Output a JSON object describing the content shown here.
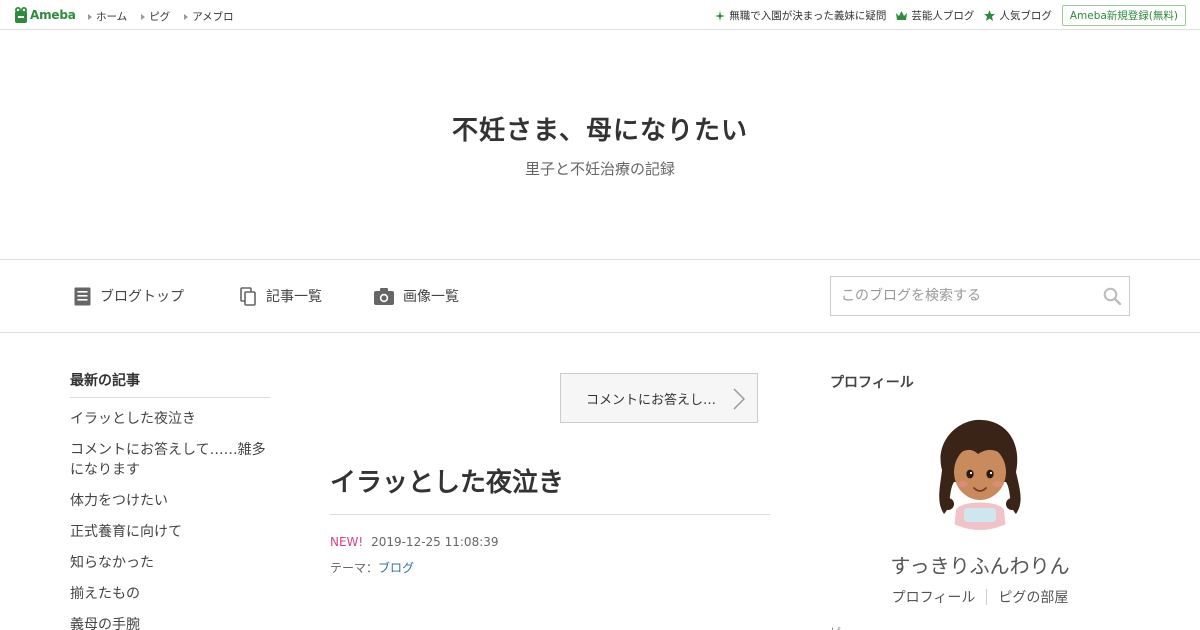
{
  "topbar": {
    "logo_text": "Ameba",
    "nav": [
      "ホーム",
      "ピグ",
      "アメブロ"
    ],
    "links": [
      {
        "icon": "sparkle-icon",
        "label": "無職で入園が決まった義妹に疑問"
      },
      {
        "icon": "crown-icon",
        "label": "芸能人ブログ"
      },
      {
        "icon": "star-icon",
        "label": "人気ブログ"
      }
    ],
    "register_label": "Ameba新規登録(無料)",
    "accent_color": "#2d8c3c"
  },
  "header": {
    "title": "不妊さま、母になりたい",
    "subtitle": "里子と不妊治療の記録"
  },
  "nav": {
    "items": [
      {
        "icon": "document-icon",
        "label": "ブログトップ"
      },
      {
        "icon": "copy-icon",
        "label": "記事一覧"
      },
      {
        "icon": "camera-icon",
        "label": "画像一覧"
      }
    ],
    "search_placeholder": "このブログを検索する"
  },
  "sidebar_left": {
    "heading": "最新の記事",
    "items": [
      "イラッとした夜泣き",
      "コメントにお答えして……雑多になります",
      "体力をつけたい",
      "正式養育に向けて",
      "知らなかった",
      "揃えたもの",
      "義母の手腕"
    ]
  },
  "main": {
    "next_label": "コメントにお答えし…",
    "entry_title": "イラッとした夜泣き",
    "new_badge": "NEW!",
    "date": "2019-12-25 11:08:39",
    "theme_label": "テーマ：",
    "theme_value": "ブログ",
    "new_color": "#d94089"
  },
  "sidebar_right": {
    "heading": "プロフィール",
    "username": "すっきりふんわりん",
    "links": [
      "プロフィール",
      "ピグの部屋"
    ],
    "cut_text": "ピ"
  }
}
